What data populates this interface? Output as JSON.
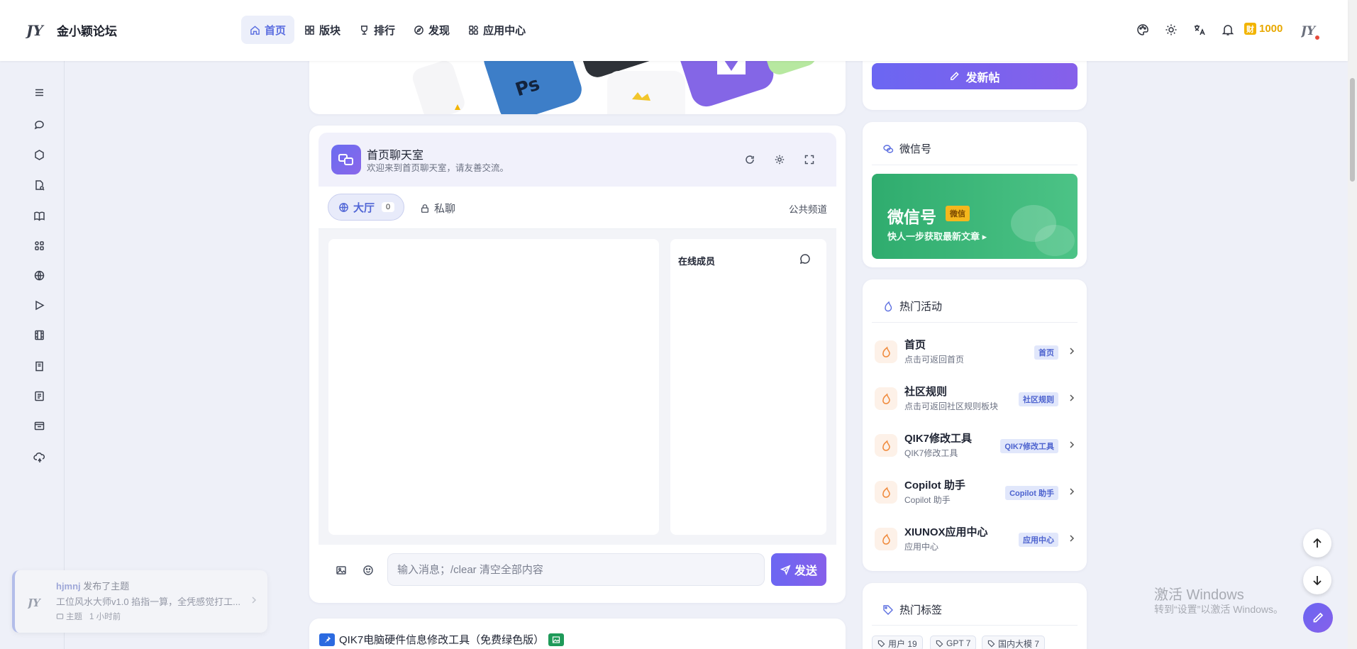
{
  "header": {
    "site_name": "金小颖论坛",
    "nav": [
      {
        "label": "首页",
        "icon": "home-icon",
        "active": true
      },
      {
        "label": "版块",
        "icon": "grid-icon"
      },
      {
        "label": "排行",
        "icon": "trophy-icon"
      },
      {
        "label": "发现",
        "icon": "compass-icon"
      },
      {
        "label": "应用中心",
        "icon": "apps-icon"
      }
    ],
    "coin_badge": "财",
    "coins": "1000"
  },
  "sidebar": {
    "icons": [
      "menu-icon",
      "chat-icon",
      "hexagon-icon",
      "file-search-icon",
      "book-open-icon",
      "apps-icon",
      "globe-icon",
      "play-icon",
      "film-icon",
      "book-icon",
      "list-icon",
      "mail-icon",
      "cloud-sync-icon"
    ]
  },
  "chat": {
    "title": "首页聊天室",
    "subtitle": "欢迎来到首页聊天室，请友善交流。",
    "tab_hall": "大厅",
    "hall_count": "0",
    "tab_private": "私聊",
    "public_channel": "公共频道",
    "members_title": "在线成员",
    "input_placeholder": "输入消息；/clear 清空全部内容",
    "send_label": "发送"
  },
  "right": {
    "new_post": "发新帖",
    "wechat_section": "微信号",
    "wechat_banner_title": "微信号",
    "wechat_banner_badge": "微信",
    "wechat_banner_sub": "快人一步获取最新文章 ▸",
    "activities_title": "热门活动",
    "activities": [
      {
        "name": "首页",
        "desc": "点击可返回首页",
        "tag": "首页"
      },
      {
        "name": "社区规则",
        "desc": "点击可返回社区规则板块",
        "tag": "社区规则"
      },
      {
        "name": "QIK7修改工具",
        "desc": "QIK7修改工具",
        "tag": "QIK7修改工具"
      },
      {
        "name": "Copilot 助手",
        "desc": "Copilot 助手",
        "tag": "Copilot 助手"
      },
      {
        "name": "XIUNOX应用中心",
        "desc": "应用中心",
        "tag": "应用中心"
      }
    ],
    "tags_title": "热门标签",
    "tags": [
      "用户 19",
      "GPT 7",
      "国内大模 7"
    ]
  },
  "post": {
    "title": "QIK7电脑硬件信息修改工具（免费绿色版）"
  },
  "toast": {
    "user": "hjmnj",
    "action": "发布了主题",
    "text": "工位风水大师v1.0 掐指一算，全凭感觉打工...",
    "type": "主题",
    "time": "1 小时前"
  },
  "windows": {
    "title": "激活 Windows",
    "subtitle": "转到“设置”以激活 Windows。"
  },
  "colors": {
    "accent": "#6b66f2",
    "wechat_green": "#2fac6e",
    "coin": "#e8a800"
  }
}
